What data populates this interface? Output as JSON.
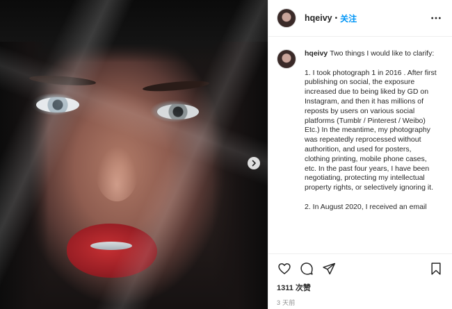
{
  "post": {
    "username": "hqeivy",
    "follow_label": "关注",
    "caption_username": "hqeivy",
    "caption_paragraphs": [
      "Two things I would like to clarify:",
      "1. I took photograph 1 in 2016 . After first publishing on social, the exposure increased due to being liked by GD on Instagram, and then it has millions of reposts by users on various social platforms (Tumblr / Pinterest / Weibo) Etc.) In the meantime, my photography was repeatedly reprocessed without authorition, and used for posters, clothing printing, mobile phone cases, etc. In the past four years, I have been negotiating, protecting my intellectual property rights, or selectively ignoring it.",
      "2. In August 2020, I received an email"
    ],
    "likes_label": "1311 次赞",
    "timestamp": "3 天前"
  },
  "icons": {
    "next": "chevron-right-icon",
    "more": "more-options-icon",
    "like": "heart-icon",
    "comment": "comment-icon",
    "share": "share-icon",
    "save": "bookmark-icon"
  },
  "colors": {
    "accent": "#0095f6",
    "text": "#262626",
    "muted": "#8e8e8e",
    "border": "#efefef"
  }
}
